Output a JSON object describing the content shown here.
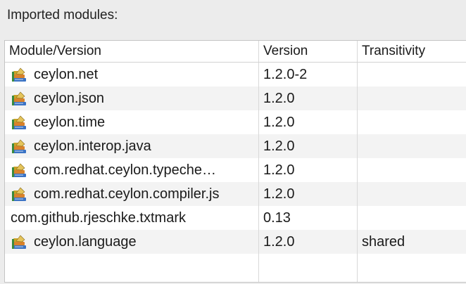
{
  "section": {
    "title": "Imported modules:"
  },
  "table": {
    "columns": [
      "Module/Version",
      "Version",
      "Transitivity"
    ],
    "rows": [
      {
        "module": "ceylon.net",
        "version": "1.2.0-2",
        "transitivity": "",
        "icon": "module-jar-icon"
      },
      {
        "module": "ceylon.json",
        "version": "1.2.0",
        "transitivity": "",
        "icon": "module-jar-icon"
      },
      {
        "module": "ceylon.time",
        "version": "1.2.0",
        "transitivity": "",
        "icon": "module-jar-icon"
      },
      {
        "module": "ceylon.interop.java",
        "version": "1.2.0",
        "transitivity": "",
        "icon": "module-jar-icon"
      },
      {
        "module": "com.redhat.ceylon.typeche…",
        "version": "1.2.0",
        "transitivity": "",
        "icon": "module-jar-icon"
      },
      {
        "module": "com.redhat.ceylon.compiler.js",
        "version": "1.2.0",
        "transitivity": "",
        "icon": "module-jar-icon"
      },
      {
        "module": "com.github.rjeschke.txtmark",
        "version": "0.13",
        "transitivity": "",
        "icon": ""
      },
      {
        "module": "ceylon.language",
        "version": "1.2.0",
        "transitivity": "shared",
        "icon": "module-jar-icon"
      }
    ]
  },
  "colors": {
    "panel_bg": "#ececec",
    "table_bg": "#ffffff",
    "alt_row_bg": "#f3f3f3"
  }
}
